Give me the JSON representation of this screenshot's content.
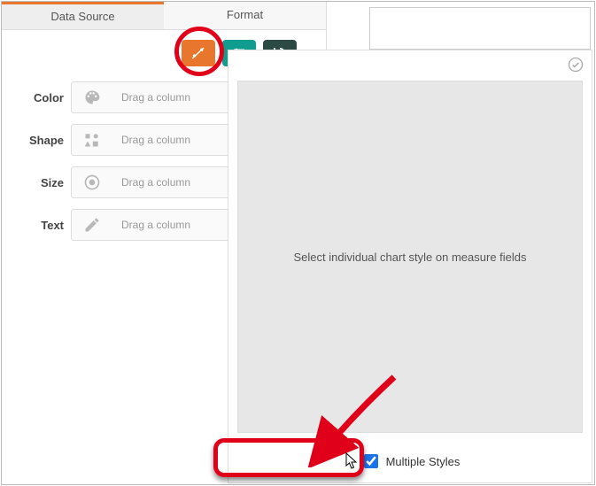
{
  "tabs": {
    "data_source": "Data Source",
    "format": "Format"
  },
  "properties": {
    "color": {
      "label": "Color",
      "placeholder": "Drag a column"
    },
    "shape": {
      "label": "Shape",
      "placeholder": "Drag a column"
    },
    "size": {
      "label": "Size",
      "placeholder": "Drag a column"
    },
    "text": {
      "label": "Text",
      "placeholder": "Drag a column"
    }
  },
  "overlay": {
    "message": "Select individual chart style on measure fields",
    "checkbox_label": "Multiple Styles",
    "checked": true
  },
  "icons": {
    "scatter_tool": "scatter-control-icon",
    "adjust_tool": "adjust-icon",
    "reset_tool": "reset-icon"
  }
}
